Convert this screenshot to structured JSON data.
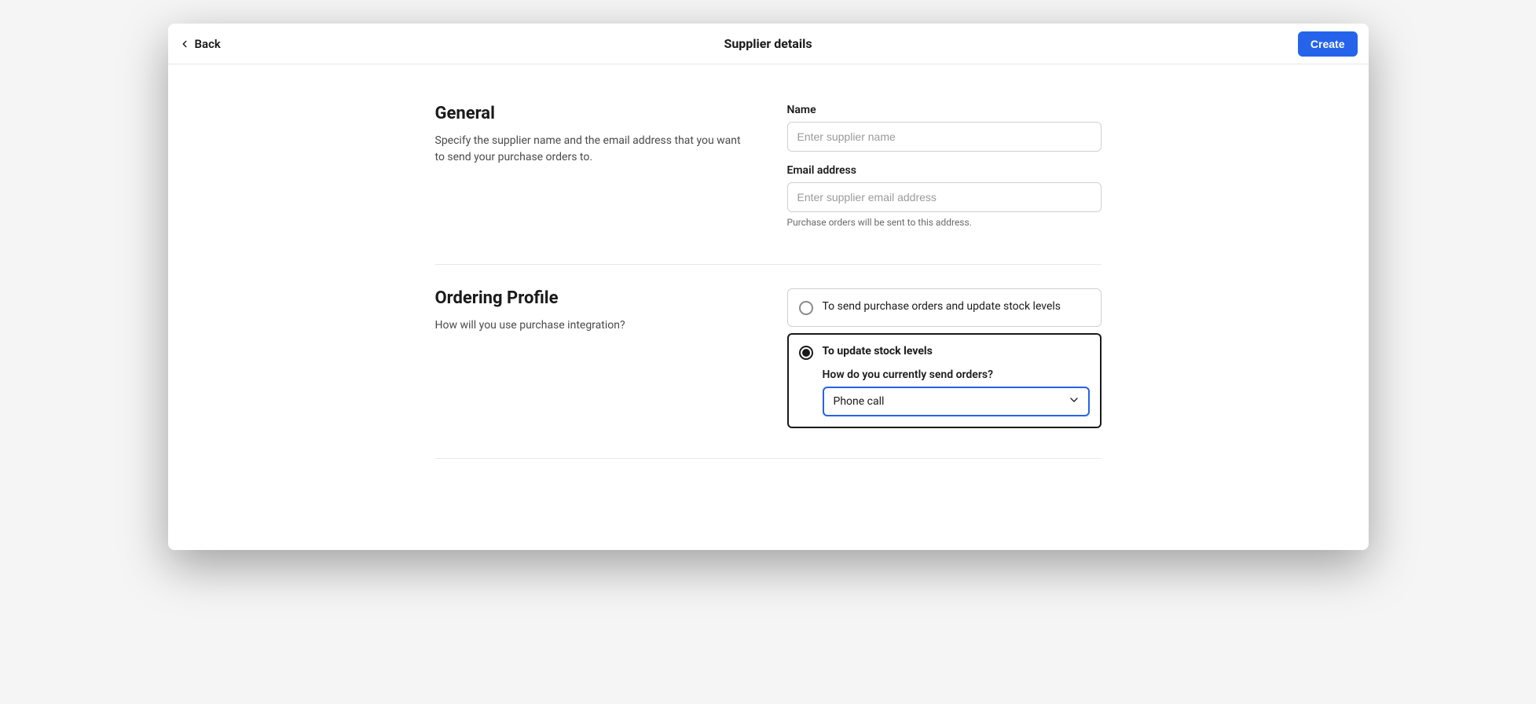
{
  "header": {
    "back_label": "Back",
    "title": "Supplier details",
    "create_label": "Create"
  },
  "general": {
    "title": "General",
    "description": "Specify the supplier name and the email address that you want to send your purchase orders to.",
    "name_label": "Name",
    "name_placeholder": "Enter supplier name",
    "name_value": "",
    "email_label": "Email address",
    "email_placeholder": "Enter supplier email address",
    "email_value": "",
    "email_hint": "Purchase orders will be sent to this address."
  },
  "ordering": {
    "title": "Ordering Profile",
    "description": "How will you use purchase integration?",
    "option_send": "To send purchase orders and update stock levels",
    "option_update": "To update stock levels",
    "nested_label": "How do you currently send orders?",
    "nested_value": "Phone call"
  }
}
